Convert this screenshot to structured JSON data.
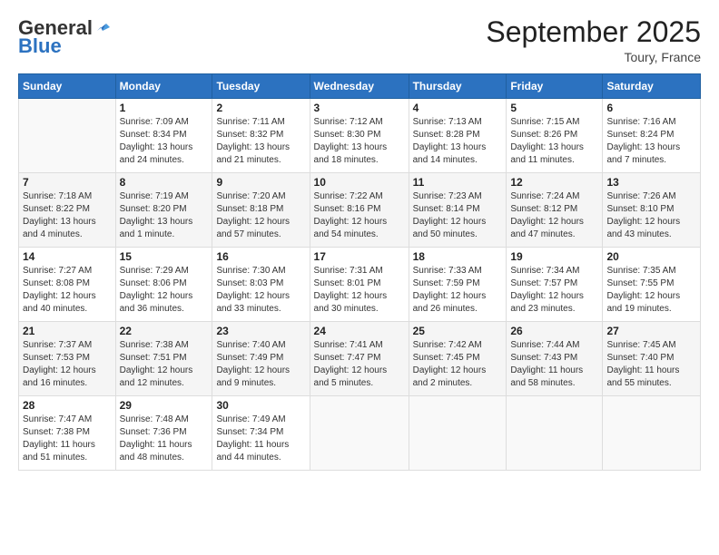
{
  "header": {
    "logo_general": "General",
    "logo_blue": "Blue",
    "main_title": "September 2025",
    "subtitle": "Toury, France"
  },
  "columns": [
    "Sunday",
    "Monday",
    "Tuesday",
    "Wednesday",
    "Thursday",
    "Friday",
    "Saturday"
  ],
  "weeks": [
    [
      {
        "day": "",
        "sunrise": "",
        "sunset": "",
        "daylight": ""
      },
      {
        "day": "1",
        "sunrise": "Sunrise: 7:09 AM",
        "sunset": "Sunset: 8:34 PM",
        "daylight": "Daylight: 13 hours and 24 minutes."
      },
      {
        "day": "2",
        "sunrise": "Sunrise: 7:11 AM",
        "sunset": "Sunset: 8:32 PM",
        "daylight": "Daylight: 13 hours and 21 minutes."
      },
      {
        "day": "3",
        "sunrise": "Sunrise: 7:12 AM",
        "sunset": "Sunset: 8:30 PM",
        "daylight": "Daylight: 13 hours and 18 minutes."
      },
      {
        "day": "4",
        "sunrise": "Sunrise: 7:13 AM",
        "sunset": "Sunset: 8:28 PM",
        "daylight": "Daylight: 13 hours and 14 minutes."
      },
      {
        "day": "5",
        "sunrise": "Sunrise: 7:15 AM",
        "sunset": "Sunset: 8:26 PM",
        "daylight": "Daylight: 13 hours and 11 minutes."
      },
      {
        "day": "6",
        "sunrise": "Sunrise: 7:16 AM",
        "sunset": "Sunset: 8:24 PM",
        "daylight": "Daylight: 13 hours and 7 minutes."
      }
    ],
    [
      {
        "day": "7",
        "sunrise": "Sunrise: 7:18 AM",
        "sunset": "Sunset: 8:22 PM",
        "daylight": "Daylight: 13 hours and 4 minutes."
      },
      {
        "day": "8",
        "sunrise": "Sunrise: 7:19 AM",
        "sunset": "Sunset: 8:20 PM",
        "daylight": "Daylight: 13 hours and 1 minute."
      },
      {
        "day": "9",
        "sunrise": "Sunrise: 7:20 AM",
        "sunset": "Sunset: 8:18 PM",
        "daylight": "Daylight: 12 hours and 57 minutes."
      },
      {
        "day": "10",
        "sunrise": "Sunrise: 7:22 AM",
        "sunset": "Sunset: 8:16 PM",
        "daylight": "Daylight: 12 hours and 54 minutes."
      },
      {
        "day": "11",
        "sunrise": "Sunrise: 7:23 AM",
        "sunset": "Sunset: 8:14 PM",
        "daylight": "Daylight: 12 hours and 50 minutes."
      },
      {
        "day": "12",
        "sunrise": "Sunrise: 7:24 AM",
        "sunset": "Sunset: 8:12 PM",
        "daylight": "Daylight: 12 hours and 47 minutes."
      },
      {
        "day": "13",
        "sunrise": "Sunrise: 7:26 AM",
        "sunset": "Sunset: 8:10 PM",
        "daylight": "Daylight: 12 hours and 43 minutes."
      }
    ],
    [
      {
        "day": "14",
        "sunrise": "Sunrise: 7:27 AM",
        "sunset": "Sunset: 8:08 PM",
        "daylight": "Daylight: 12 hours and 40 minutes."
      },
      {
        "day": "15",
        "sunrise": "Sunrise: 7:29 AM",
        "sunset": "Sunset: 8:06 PM",
        "daylight": "Daylight: 12 hours and 36 minutes."
      },
      {
        "day": "16",
        "sunrise": "Sunrise: 7:30 AM",
        "sunset": "Sunset: 8:03 PM",
        "daylight": "Daylight: 12 hours and 33 minutes."
      },
      {
        "day": "17",
        "sunrise": "Sunrise: 7:31 AM",
        "sunset": "Sunset: 8:01 PM",
        "daylight": "Daylight: 12 hours and 30 minutes."
      },
      {
        "day": "18",
        "sunrise": "Sunrise: 7:33 AM",
        "sunset": "Sunset: 7:59 PM",
        "daylight": "Daylight: 12 hours and 26 minutes."
      },
      {
        "day": "19",
        "sunrise": "Sunrise: 7:34 AM",
        "sunset": "Sunset: 7:57 PM",
        "daylight": "Daylight: 12 hours and 23 minutes."
      },
      {
        "day": "20",
        "sunrise": "Sunrise: 7:35 AM",
        "sunset": "Sunset: 7:55 PM",
        "daylight": "Daylight: 12 hours and 19 minutes."
      }
    ],
    [
      {
        "day": "21",
        "sunrise": "Sunrise: 7:37 AM",
        "sunset": "Sunset: 7:53 PM",
        "daylight": "Daylight: 12 hours and 16 minutes."
      },
      {
        "day": "22",
        "sunrise": "Sunrise: 7:38 AM",
        "sunset": "Sunset: 7:51 PM",
        "daylight": "Daylight: 12 hours and 12 minutes."
      },
      {
        "day": "23",
        "sunrise": "Sunrise: 7:40 AM",
        "sunset": "Sunset: 7:49 PM",
        "daylight": "Daylight: 12 hours and 9 minutes."
      },
      {
        "day": "24",
        "sunrise": "Sunrise: 7:41 AM",
        "sunset": "Sunset: 7:47 PM",
        "daylight": "Daylight: 12 hours and 5 minutes."
      },
      {
        "day": "25",
        "sunrise": "Sunrise: 7:42 AM",
        "sunset": "Sunset: 7:45 PM",
        "daylight": "Daylight: 12 hours and 2 minutes."
      },
      {
        "day": "26",
        "sunrise": "Sunrise: 7:44 AM",
        "sunset": "Sunset: 7:43 PM",
        "daylight": "Daylight: 11 hours and 58 minutes."
      },
      {
        "day": "27",
        "sunrise": "Sunrise: 7:45 AM",
        "sunset": "Sunset: 7:40 PM",
        "daylight": "Daylight: 11 hours and 55 minutes."
      }
    ],
    [
      {
        "day": "28",
        "sunrise": "Sunrise: 7:47 AM",
        "sunset": "Sunset: 7:38 PM",
        "daylight": "Daylight: 11 hours and 51 minutes."
      },
      {
        "day": "29",
        "sunrise": "Sunrise: 7:48 AM",
        "sunset": "Sunset: 7:36 PM",
        "daylight": "Daylight: 11 hours and 48 minutes."
      },
      {
        "day": "30",
        "sunrise": "Sunrise: 7:49 AM",
        "sunset": "Sunset: 7:34 PM",
        "daylight": "Daylight: 11 hours and 44 minutes."
      },
      {
        "day": "",
        "sunrise": "",
        "sunset": "",
        "daylight": ""
      },
      {
        "day": "",
        "sunrise": "",
        "sunset": "",
        "daylight": ""
      },
      {
        "day": "",
        "sunrise": "",
        "sunset": "",
        "daylight": ""
      },
      {
        "day": "",
        "sunrise": "",
        "sunset": "",
        "daylight": ""
      }
    ]
  ]
}
